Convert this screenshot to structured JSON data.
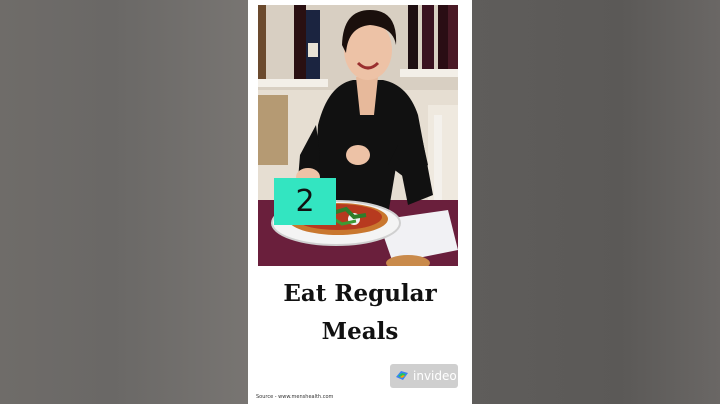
{
  "card": {
    "step_number": "2",
    "headline_line1": "Eat Regular",
    "headline_line2": "Meals",
    "watermark": "invideo",
    "source": "Source - www.menshealth.com"
  },
  "colors": {
    "badge": "#33e5c1",
    "tablecloth": "#6a1f3c",
    "card_background": "#ffffff"
  },
  "icons": {
    "watermark_logo": "invideo-logo-icon"
  }
}
